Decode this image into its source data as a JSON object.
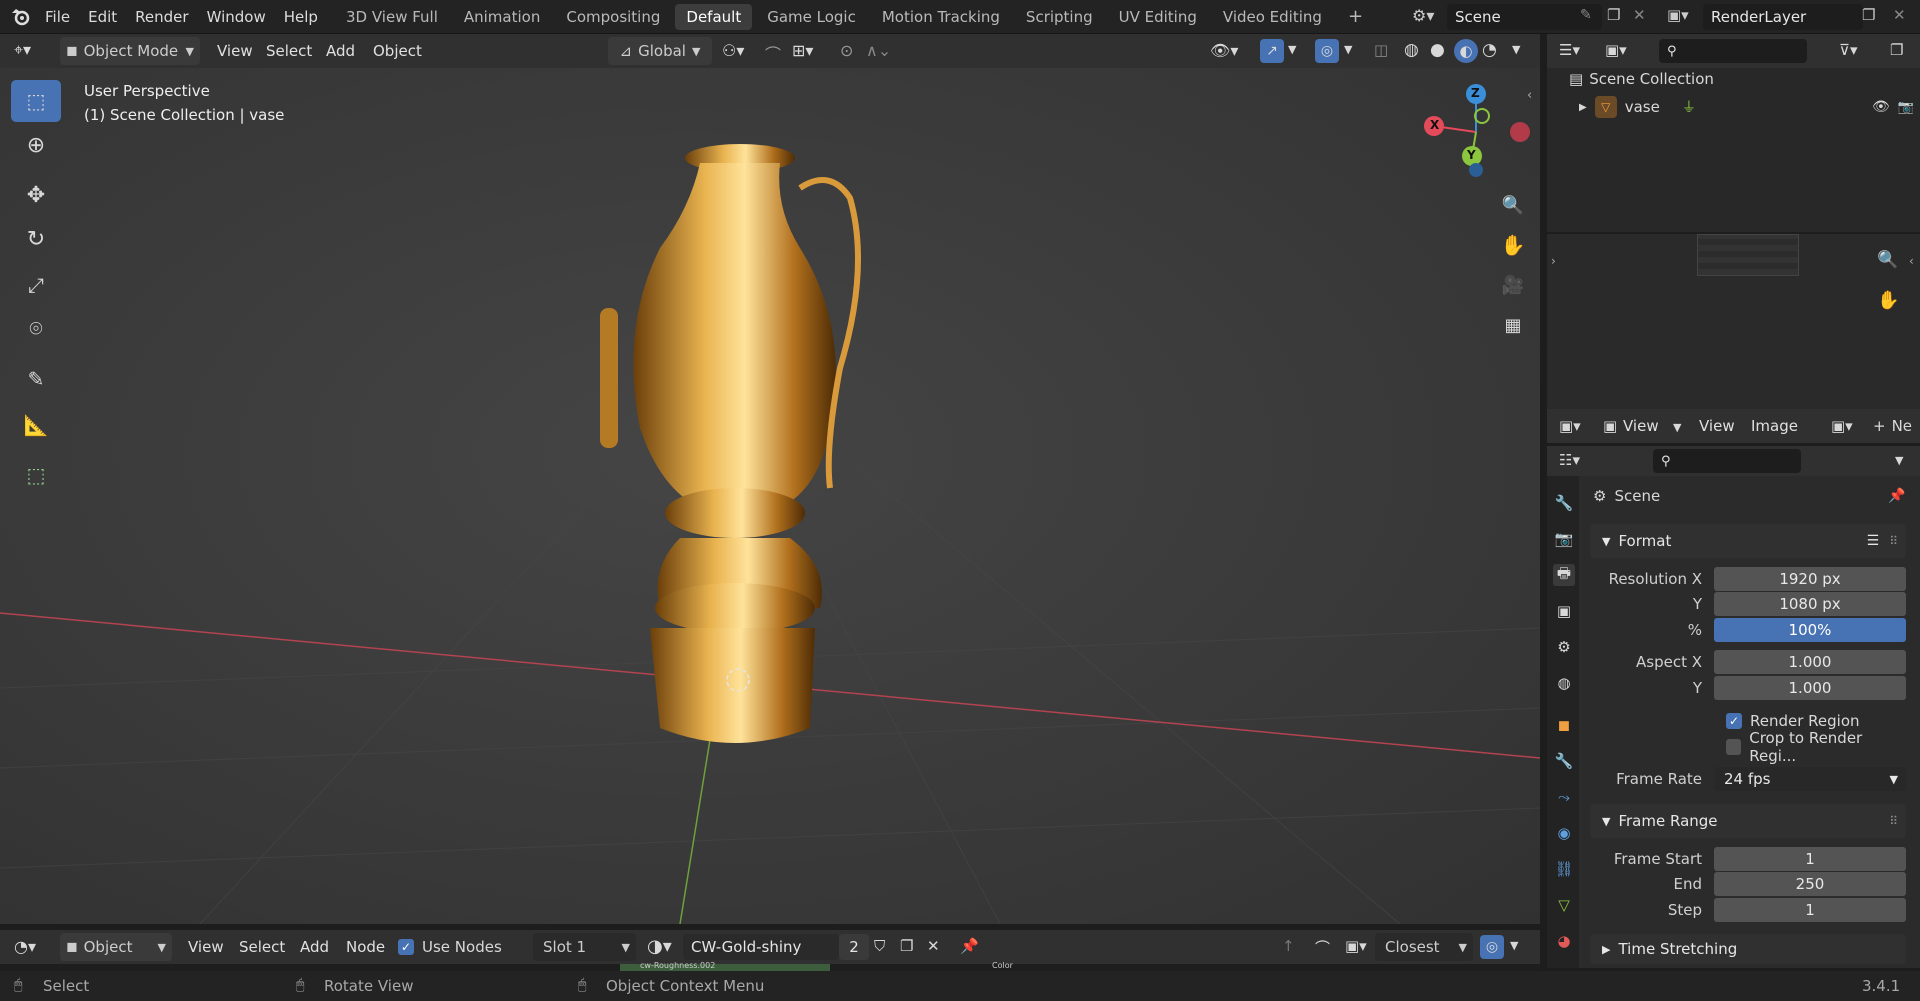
{
  "app": {
    "version": "3.4.1"
  },
  "menu": [
    {
      "label": "File"
    },
    {
      "label": "Edit"
    },
    {
      "label": "Render"
    },
    {
      "label": "Window"
    },
    {
      "label": "Help"
    }
  ],
  "workspaces": [
    {
      "label": "3D View Full"
    },
    {
      "label": "Animation"
    },
    {
      "label": "Compositing"
    },
    {
      "label": "Default",
      "active": true
    },
    {
      "label": "Game Logic"
    },
    {
      "label": "Motion Tracking"
    },
    {
      "label": "Scripting"
    },
    {
      "label": "UV Editing"
    },
    {
      "label": "Video Editing"
    }
  ],
  "topright": {
    "scene": "Scene",
    "view_layer": "RenderLayer"
  },
  "viewport_header": {
    "mode": "Object Mode",
    "menus": [
      "View",
      "Select",
      "Add",
      "Object"
    ],
    "orientation": "Global"
  },
  "viewport": {
    "perspective": "User Perspective",
    "context": "(1) Scene Collection | vase"
  },
  "gizmo": {
    "x": "X",
    "y": "Y",
    "z": "Z"
  },
  "outliner": {
    "root": "Scene Collection",
    "items": [
      {
        "label": "vase"
      }
    ]
  },
  "image_editor": {
    "menus": [
      "View",
      "View",
      "Image"
    ],
    "new_label": "Ne"
  },
  "properties": {
    "context": "Scene",
    "format_panel": "Format",
    "resolution_x_label": "Resolution X",
    "resolution_x": "1920 px",
    "resolution_y_label": "Y",
    "resolution_y": "1080 px",
    "percent_label": "%",
    "percent": "100%",
    "aspect_x_label": "Aspect X",
    "aspect_x": "1.000",
    "aspect_y_label": "Y",
    "aspect_y": "1.000",
    "render_region": "Render Region",
    "render_region_checked": true,
    "crop_region": "Crop to Render Regi...",
    "crop_region_checked": false,
    "frame_rate_label": "Frame Rate",
    "frame_rate": "24 fps",
    "frame_range_panel": "Frame Range",
    "frame_start_label": "Frame Start",
    "frame_start": "1",
    "frame_end_label": "End",
    "frame_end": "250",
    "frame_step_label": "Step",
    "frame_step": "1",
    "time_stretching": "Time Stretching"
  },
  "node_header": {
    "mode": "Object",
    "menus": [
      "View",
      "Select",
      "Add",
      "Node"
    ],
    "use_nodes": "Use Nodes",
    "use_nodes_checked": true,
    "slot": "Slot 1",
    "material": "CW-Gold-shiny",
    "users": "2",
    "snap": "Closest",
    "node_label_a": "cw-Roughness.002",
    "node_label_b": "Color"
  },
  "status": {
    "select": "Select",
    "rotate": "Rotate View",
    "context_menu": "Object Context Menu"
  },
  "colors": {
    "accent": "#4772b3",
    "gold": "#c88a2e",
    "axis_x": "#e34a5a",
    "axis_y": "#8cc63f",
    "axis_z": "#3b8fd9"
  }
}
